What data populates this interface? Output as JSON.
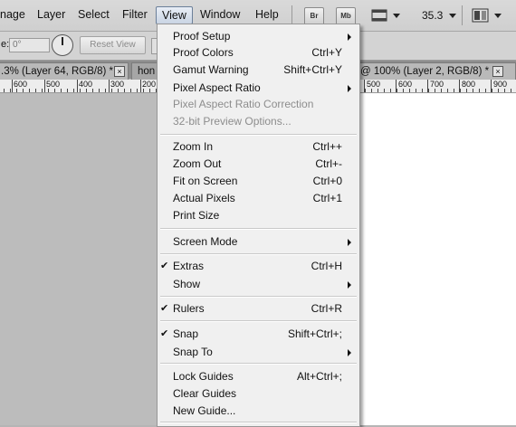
{
  "menubar": {
    "items": [
      "nage",
      "Layer",
      "Select",
      "Filter",
      "View",
      "Window",
      "Help"
    ],
    "active": "View",
    "br_label": "Br",
    "mb_label": "Mb",
    "zoom": "35.3"
  },
  "options": {
    "angle_label": "e:",
    "angle_value": "0°",
    "reset_label": "Reset View"
  },
  "tabs": {
    "left_tab": ".3% (Layer 64, RGB/8) *",
    "mid_tab": "hon",
    "right_tab": "@ 100% (Layer 2, RGB/8) *",
    "close_glyph": "×"
  },
  "ruler": {
    "left_labels": [
      "600",
      "500",
      "400",
      "300",
      "200"
    ],
    "right_labels": [
      "500",
      "600",
      "700",
      "800",
      "900"
    ]
  },
  "view_menu": {
    "items": [
      {
        "label": "Proof Setup",
        "shortcut": "",
        "submenu": true,
        "checked": false,
        "disabled": false
      },
      {
        "label": "Proof Colors",
        "shortcut": "Ctrl+Y",
        "submenu": false,
        "checked": false,
        "disabled": false
      },
      {
        "label": "Gamut Warning",
        "shortcut": "Shift+Ctrl+Y",
        "submenu": false,
        "checked": false,
        "disabled": false
      },
      {
        "label": "Pixel Aspect Ratio",
        "shortcut": "",
        "submenu": true,
        "checked": false,
        "disabled": false
      },
      {
        "label": "Pixel Aspect Ratio Correction",
        "shortcut": "",
        "submenu": false,
        "checked": false,
        "disabled": true
      },
      {
        "label": "32-bit Preview Options...",
        "shortcut": "",
        "submenu": false,
        "checked": false,
        "disabled": true
      },
      {
        "label": "Zoom In",
        "shortcut": "Ctrl++",
        "submenu": false,
        "checked": false,
        "disabled": false
      },
      {
        "label": "Zoom Out",
        "shortcut": "Ctrl+-",
        "submenu": false,
        "checked": false,
        "disabled": false
      },
      {
        "label": "Fit on Screen",
        "shortcut": "Ctrl+0",
        "submenu": false,
        "checked": false,
        "disabled": false
      },
      {
        "label": "Actual Pixels",
        "shortcut": "Ctrl+1",
        "submenu": false,
        "checked": false,
        "disabled": false
      },
      {
        "label": "Print Size",
        "shortcut": "",
        "submenu": false,
        "checked": false,
        "disabled": false
      },
      {
        "label": "Screen Mode",
        "shortcut": "",
        "submenu": true,
        "checked": false,
        "disabled": false
      },
      {
        "label": "Extras",
        "shortcut": "Ctrl+H",
        "submenu": false,
        "checked": true,
        "disabled": false
      },
      {
        "label": "Show",
        "shortcut": "",
        "submenu": true,
        "checked": false,
        "disabled": false
      },
      {
        "label": "Rulers",
        "shortcut": "Ctrl+R",
        "submenu": false,
        "checked": true,
        "disabled": false
      },
      {
        "label": "Snap",
        "shortcut": "Shift+Ctrl+;",
        "submenu": false,
        "checked": true,
        "disabled": false
      },
      {
        "label": "Snap To",
        "shortcut": "",
        "submenu": true,
        "checked": false,
        "disabled": false
      },
      {
        "label": "Lock Guides",
        "shortcut": "Alt+Ctrl+;",
        "submenu": false,
        "checked": false,
        "disabled": false
      },
      {
        "label": "Clear Guides",
        "shortcut": "",
        "submenu": false,
        "checked": false,
        "disabled": false
      },
      {
        "label": "New Guide...",
        "shortcut": "",
        "submenu": false,
        "checked": false,
        "disabled": false
      }
    ],
    "check_glyph": "✔"
  }
}
